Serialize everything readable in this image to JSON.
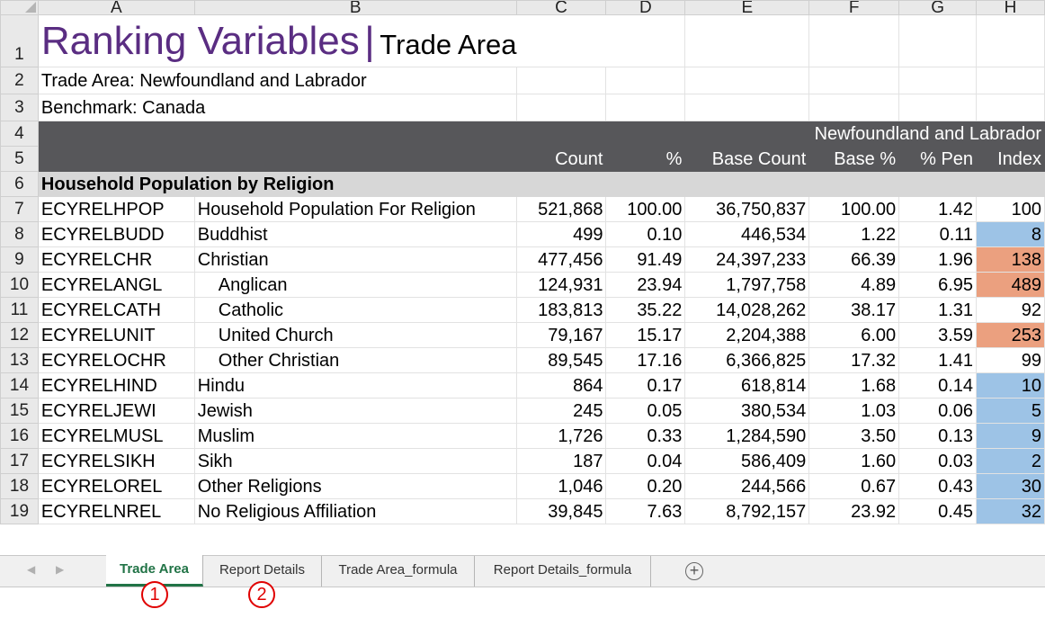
{
  "columns": [
    "A",
    "B",
    "C",
    "D",
    "E",
    "F",
    "G",
    "H"
  ],
  "title": {
    "main": "Ranking Variables",
    "separator": "|",
    "sub": "Trade Area"
  },
  "trade_area_line": "Trade Area: Newfoundland and Labrador",
  "benchmark_line": "Benchmark: Canada",
  "header": {
    "group": "Newfoundland and Labrador",
    "cols": [
      "Count",
      "%",
      "Base Count",
      "Base %",
      "% Pen",
      "Index"
    ]
  },
  "section": "Household Population by Religion",
  "rows": [
    {
      "row": "7",
      "code": "ECYRELHPOP",
      "desc": "Household Population For Religion",
      "indent": false,
      "count": "521,868",
      "pct": "100.00",
      "base_count": "36,750,837",
      "base_pct": "100.00",
      "pen": "1.42",
      "index": "100",
      "shade": "none"
    },
    {
      "row": "8",
      "code": "ECYRELBUDD",
      "desc": "Buddhist",
      "indent": false,
      "count": "499",
      "pct": "0.10",
      "base_count": "446,534",
      "base_pct": "1.22",
      "pen": "0.11",
      "index": "8",
      "shade": "blue"
    },
    {
      "row": "9",
      "code": "ECYRELCHR",
      "desc": "Christian",
      "indent": false,
      "count": "477,456",
      "pct": "91.49",
      "base_count": "24,397,233",
      "base_pct": "66.39",
      "pen": "1.96",
      "index": "138",
      "shade": "orange"
    },
    {
      "row": "10",
      "code": "ECYRELANGL",
      "desc": "Anglican",
      "indent": true,
      "count": "124,931",
      "pct": "23.94",
      "base_count": "1,797,758",
      "base_pct": "4.89",
      "pen": "6.95",
      "index": "489",
      "shade": "orange"
    },
    {
      "row": "11",
      "code": "ECYRELCATH",
      "desc": "Catholic",
      "indent": true,
      "count": "183,813",
      "pct": "35.22",
      "base_count": "14,028,262",
      "base_pct": "38.17",
      "pen": "1.31",
      "index": "92",
      "shade": "none"
    },
    {
      "row": "12",
      "code": "ECYRELUNIT",
      "desc": "United Church",
      "indent": true,
      "count": "79,167",
      "pct": "15.17",
      "base_count": "2,204,388",
      "base_pct": "6.00",
      "pen": "3.59",
      "index": "253",
      "shade": "orange"
    },
    {
      "row": "13",
      "code": "ECYRELOCHR",
      "desc": "Other Christian",
      "indent": true,
      "count": "89,545",
      "pct": "17.16",
      "base_count": "6,366,825",
      "base_pct": "17.32",
      "pen": "1.41",
      "index": "99",
      "shade": "none"
    },
    {
      "row": "14",
      "code": "ECYRELHIND",
      "desc": "Hindu",
      "indent": false,
      "count": "864",
      "pct": "0.17",
      "base_count": "618,814",
      "base_pct": "1.68",
      "pen": "0.14",
      "index": "10",
      "shade": "blue"
    },
    {
      "row": "15",
      "code": "ECYRELJEWI",
      "desc": "Jewish",
      "indent": false,
      "count": "245",
      "pct": "0.05",
      "base_count": "380,534",
      "base_pct": "1.03",
      "pen": "0.06",
      "index": "5",
      "shade": "blue"
    },
    {
      "row": "16",
      "code": "ECYRELMUSL",
      "desc": "Muslim",
      "indent": false,
      "count": "1,726",
      "pct": "0.33",
      "base_count": "1,284,590",
      "base_pct": "3.50",
      "pen": "0.13",
      "index": "9",
      "shade": "blue"
    },
    {
      "row": "17",
      "code": "ECYRELSIKH",
      "desc": "Sikh",
      "indent": false,
      "count": "187",
      "pct": "0.04",
      "base_count": "586,409",
      "base_pct": "1.60",
      "pen": "0.03",
      "index": "2",
      "shade": "blue"
    },
    {
      "row": "18",
      "code": "ECYRELOREL",
      "desc": "Other Religions",
      "indent": false,
      "count": "1,046",
      "pct": "0.20",
      "base_count": "244,566",
      "base_pct": "0.67",
      "pen": "0.43",
      "index": "30",
      "shade": "blue"
    },
    {
      "row": "19",
      "code": "ECYRELNREL",
      "desc": "No Religious Affiliation",
      "indent": false,
      "count": "39,845",
      "pct": "7.63",
      "base_count": "8,792,157",
      "base_pct": "23.92",
      "pen": "0.45",
      "index": "32",
      "shade": "blue"
    }
  ],
  "tabs": [
    "Trade Area",
    "Report Details",
    "Trade Area_formula",
    "Report Details_formula"
  ],
  "active_tab": "Trade Area",
  "nav_icons": [
    "scroll-left-icon",
    "scroll-right-icon"
  ],
  "add_sheet_icon": "plus-circle-icon",
  "add_sheet_glyph": "+",
  "callouts": [
    "1",
    "2"
  ],
  "colors": {
    "title": "#5a2d82",
    "header_band": "#57575a",
    "section_band": "#d7d7d7",
    "index_low": "#9dc3e6",
    "index_high": "#eba07f",
    "active_tab": "#217346",
    "callout": "#e00000"
  }
}
